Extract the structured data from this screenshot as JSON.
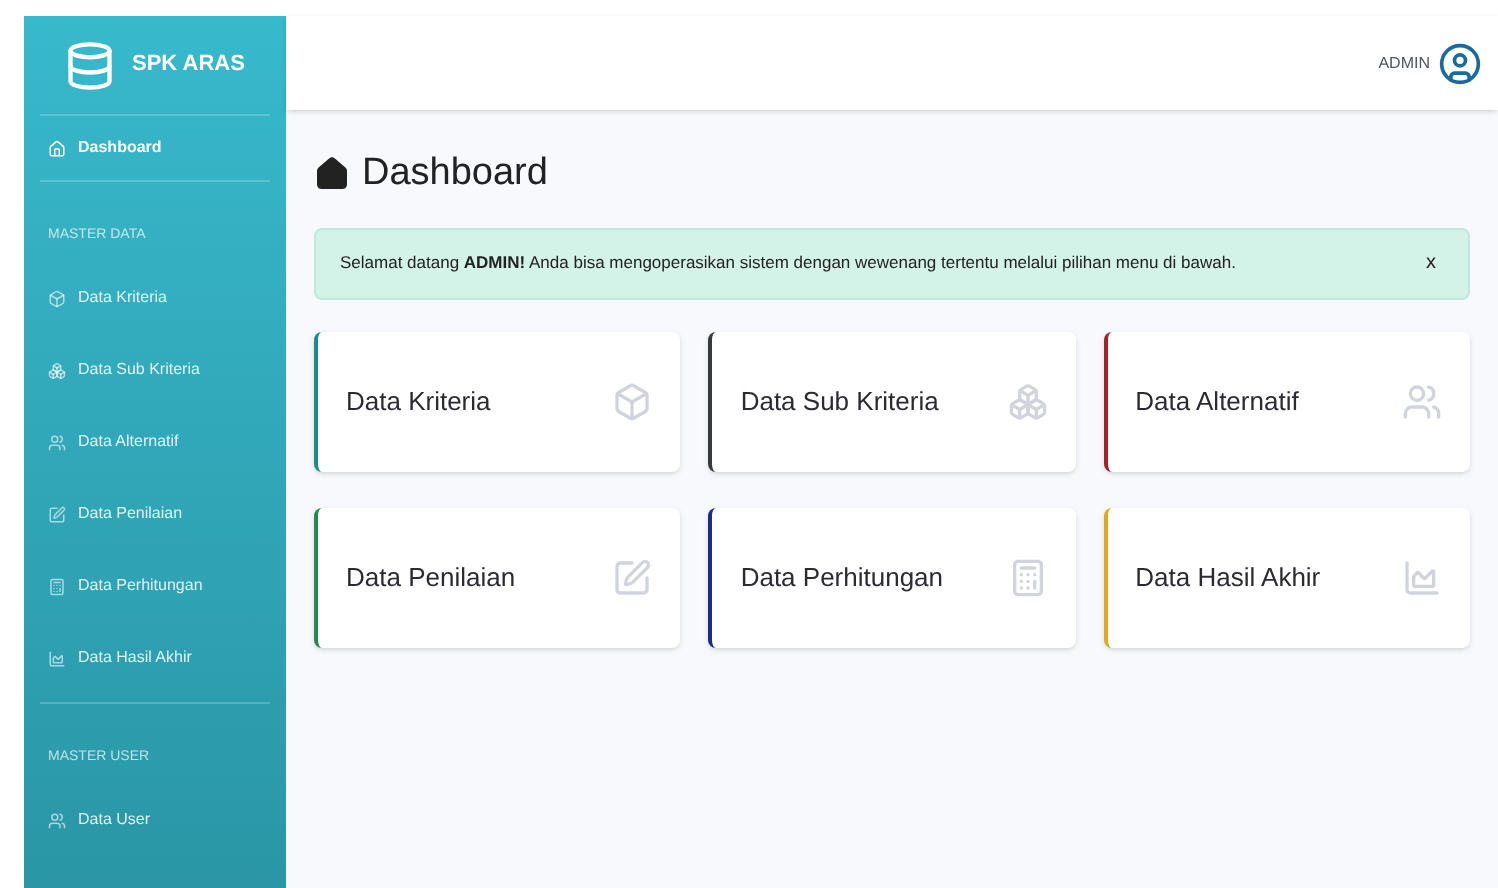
{
  "sidebar": {
    "brand": "SPK ARAS",
    "items": [
      {
        "kind": "link",
        "label": "Dashboard",
        "selected": true
      },
      {
        "kind": "header",
        "label": "MASTER DATA"
      },
      {
        "kind": "link",
        "label": "Data Kriteria",
        "selected": false
      },
      {
        "kind": "link",
        "label": "Data Sub Kriteria",
        "selected": false
      },
      {
        "kind": "link",
        "label": "Data Alternatif",
        "selected": false
      },
      {
        "kind": "link",
        "label": "Data Penilaian",
        "selected": false
      },
      {
        "kind": "link",
        "label": "Data Perhitungan",
        "selected": false
      },
      {
        "kind": "link",
        "label": "Data Hasil Akhir",
        "selected": false
      },
      {
        "kind": "header",
        "label": "MASTER USER"
      },
      {
        "kind": "link",
        "label": "Data User",
        "selected": false
      }
    ]
  },
  "topbar": {
    "user": "ADMIN"
  },
  "page_title": "Dashboard",
  "alert": {
    "text": "Selamat datang **ADMIN!** Anda bisa mengoperasikan sistem dengan wewenang tertentu melalui pilihan menu di bawah.",
    "close": "x"
  },
  "cards": [
    {
      "label": "Data Kriteria",
      "color": "#1a8c8c"
    },
    {
      "label": "Data Sub Kriteria",
      "color": "#3a3a3a"
    },
    {
      "label": "Data Alternatif",
      "color": "#a3222a"
    },
    {
      "label": "Data Penilaian",
      "color": "#1f8a4c"
    },
    {
      "label": "Data Perhitungan",
      "color": "#1c2a8c"
    },
    {
      "label": "Data Hasil Akhir",
      "color": "#e0a81e"
    }
  ]
}
